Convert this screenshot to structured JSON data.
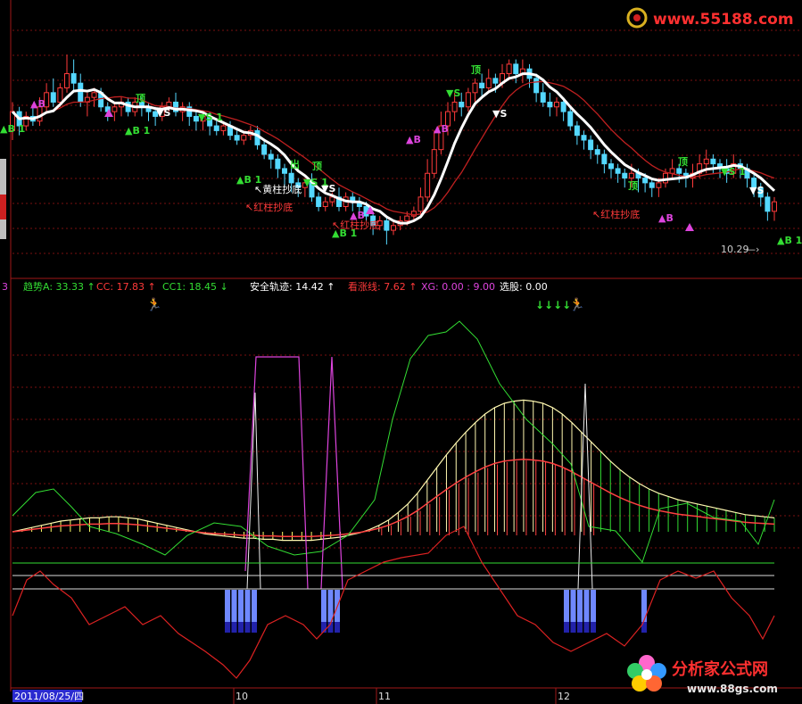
{
  "colors": {
    "background": "#000000",
    "grid": "#7a1010",
    "frame": "#a01818",
    "up": "#ff3a3a",
    "down": "#54d8ff",
    "white_line": "#ffffff",
    "red_line": "#c02020",
    "green": "#33dd33",
    "magenta": "#dd44dd",
    "yellow": "#ffff66",
    "blue_bar": "#6f88ff",
    "blue_dark": "#2222aa"
  },
  "watermarks": {
    "top": "www.55188.com",
    "bottom_title": "分析家公式网",
    "bottom_url": "www.88gs.com"
  },
  "indicator_header": {
    "prefix": "3",
    "items": [
      {
        "label": "趋势A: 33.33",
        "color": "#33dd33",
        "arrow": "↑"
      },
      {
        "label": "CC: 17.83",
        "color": "#ff3a3a",
        "arrow": "↑"
      },
      {
        "label": "CC1: 18.45",
        "color": "#33dd33",
        "arrow": "↓"
      },
      {
        "label": "安全轨迹: 14.42",
        "color": "#ffffff",
        "arrow": "↑"
      },
      {
        "label": "看涨线: 7.62",
        "color": "#ff3a3a",
        "arrow": "↑"
      },
      {
        "label": "XG: 0.00 : 9.00",
        "color": "#dd44dd",
        "arrow": ""
      },
      {
        "label": "选股: 0.00",
        "color": "#ffffff",
        "arrow": ""
      }
    ]
  },
  "price_annotations": {
    "price_label": "10.29",
    "bottom_signal": "▲B 1",
    "left_signal": "▲B 1",
    "green_arrows": "↓↓↓↓"
  },
  "signals": {
    "B1": "▲B 1",
    "S1": "▼S 1",
    "B": "▲B",
    "S": "▼S",
    "ding": "顶",
    "chu": "出",
    "chaodi": "↖红柱抄底",
    "chaodi2": "↖红柱抄底",
    "zhuchaodi": "↖黄柱抄底"
  },
  "date_axis": {
    "start_label": "2011/08/25/四",
    "months": [
      "10",
      "11",
      "12"
    ]
  },
  "chart_data": {
    "type": "candlestick",
    "title": "",
    "candles": [
      [
        52,
        56,
        50,
        58
      ],
      [
        56,
        53,
        51,
        57
      ],
      [
        53,
        55,
        52,
        56
      ],
      [
        55,
        54,
        53,
        57
      ],
      [
        54,
        57,
        53,
        59
      ],
      [
        57,
        60,
        56,
        62
      ],
      [
        60,
        58,
        57,
        63
      ],
      [
        58,
        61,
        57,
        62
      ],
      [
        61,
        64,
        60,
        68
      ],
      [
        64,
        62,
        60,
        67
      ],
      [
        62,
        58,
        57,
        64
      ],
      [
        58,
        59,
        55,
        60
      ],
      [
        59,
        60,
        57,
        61
      ],
      [
        60,
        57,
        56,
        61
      ],
      [
        57,
        56,
        54,
        58
      ],
      [
        56,
        57,
        54,
        58
      ],
      [
        57,
        58,
        55,
        59
      ],
      [
        58,
        56,
        55,
        59
      ],
      [
        56,
        58,
        55,
        59
      ],
      [
        58,
        57,
        55,
        59
      ],
      [
        57,
        56,
        54,
        58
      ],
      [
        56,
        55,
        53,
        57
      ],
      [
        55,
        57,
        54,
        58
      ],
      [
        57,
        58,
        56,
        59
      ],
      [
        58,
        56,
        55,
        60
      ],
      [
        56,
        57,
        54,
        58
      ],
      [
        57,
        55,
        53,
        58
      ],
      [
        55,
        54,
        52,
        56
      ],
      [
        54,
        55,
        52,
        56
      ],
      [
        55,
        53,
        51,
        56
      ],
      [
        53,
        52,
        51,
        54
      ],
      [
        52,
        53,
        51,
        54
      ],
      [
        53,
        51,
        50,
        54
      ],
      [
        51,
        50,
        49,
        52
      ],
      [
        50,
        51,
        49,
        52
      ],
      [
        51,
        52,
        50,
        53
      ],
      [
        52,
        49,
        48,
        53
      ],
      [
        49,
        47,
        46,
        50
      ],
      [
        47,
        46,
        44,
        48
      ],
      [
        46,
        44,
        42,
        47
      ],
      [
        44,
        43,
        40,
        45
      ],
      [
        43,
        41,
        39,
        44
      ],
      [
        41,
        40,
        38,
        42
      ],
      [
        40,
        41,
        38,
        42
      ],
      [
        41,
        38,
        37,
        43
      ],
      [
        38,
        36,
        35,
        39
      ],
      [
        36,
        37,
        35,
        38
      ],
      [
        37,
        38,
        36,
        39
      ],
      [
        38,
        36,
        35,
        40
      ],
      [
        36,
        38,
        35,
        39
      ],
      [
        38,
        37,
        35,
        39
      ],
      [
        37,
        36,
        34,
        38
      ],
      [
        36,
        34,
        33,
        37
      ],
      [
        34,
        32,
        30,
        35
      ],
      [
        32,
        33,
        31,
        34
      ],
      [
        33,
        31,
        28,
        34
      ],
      [
        31,
        32,
        30,
        33
      ],
      [
        32,
        33,
        31,
        34
      ],
      [
        33,
        34,
        32,
        35
      ],
      [
        34,
        35,
        33,
        36
      ],
      [
        35,
        38,
        34,
        40
      ],
      [
        38,
        43,
        37,
        46
      ],
      [
        43,
        48,
        42,
        52
      ],
      [
        48,
        53,
        47,
        56
      ],
      [
        53,
        56,
        51,
        58
      ],
      [
        56,
        58,
        54,
        60
      ],
      [
        58,
        57,
        55,
        60
      ],
      [
        57,
        60,
        56,
        61
      ],
      [
        60,
        62,
        58,
        63
      ],
      [
        62,
        61,
        59,
        64
      ],
      [
        61,
        63,
        60,
        65
      ],
      [
        63,
        62,
        60,
        64
      ],
      [
        62,
        64,
        61,
        66
      ],
      [
        64,
        66,
        63,
        67
      ],
      [
        66,
        64,
        62,
        67
      ],
      [
        64,
        65,
        62,
        67
      ],
      [
        65,
        63,
        61,
        66
      ],
      [
        63,
        60,
        58,
        64
      ],
      [
        60,
        58,
        57,
        62
      ],
      [
        58,
        57,
        55,
        60
      ],
      [
        57,
        58,
        55,
        59
      ],
      [
        58,
        56,
        54,
        59
      ],
      [
        56,
        53,
        52,
        57
      ],
      [
        53,
        51,
        49,
        54
      ],
      [
        51,
        50,
        48,
        52
      ],
      [
        50,
        48,
        46,
        51
      ],
      [
        48,
        47,
        45,
        49
      ],
      [
        47,
        45,
        43,
        48
      ],
      [
        45,
        44,
        42,
        46
      ],
      [
        44,
        43,
        41,
        45
      ],
      [
        43,
        42,
        40,
        44
      ],
      [
        42,
        43,
        40,
        45
      ],
      [
        43,
        42,
        39,
        44
      ],
      [
        42,
        41,
        39,
        43
      ],
      [
        41,
        40,
        38,
        42
      ],
      [
        40,
        41,
        38,
        42
      ],
      [
        41,
        43,
        40,
        44
      ],
      [
        43,
        44,
        42,
        46
      ],
      [
        44,
        43,
        41,
        45
      ],
      [
        43,
        42,
        40,
        44
      ],
      [
        42,
        43,
        40,
        45
      ],
      [
        43,
        45,
        42,
        47
      ],
      [
        45,
        46,
        43,
        48
      ],
      [
        46,
        45,
        43,
        47
      ],
      [
        45,
        44,
        42,
        46
      ],
      [
        44,
        43,
        41,
        46
      ],
      [
        43,
        45,
        42,
        47
      ],
      [
        45,
        44,
        42,
        46
      ],
      [
        44,
        42,
        40,
        45
      ],
      [
        42,
        40,
        38,
        43
      ],
      [
        40,
        38,
        36,
        41
      ],
      [
        38,
        35,
        33,
        39
      ],
      [
        35,
        37,
        33,
        38
      ]
    ],
    "osc_bars": [
      [
        2,
        2
      ],
      [
        2,
        2.2
      ],
      [
        2,
        2.4
      ],
      [
        2,
        2.6
      ],
      [
        2,
        2.8
      ],
      [
        2,
        3
      ],
      [
        2,
        3.1
      ],
      [
        2,
        3.2
      ],
      [
        2,
        3.3
      ],
      [
        2,
        3.3
      ],
      [
        2,
        3.4
      ],
      [
        2,
        3.4
      ],
      [
        2,
        3.3
      ],
      [
        2,
        3.2
      ],
      [
        2,
        3.0
      ],
      [
        2,
        2.8
      ],
      [
        2,
        2.6
      ],
      [
        2,
        2.4
      ],
      [
        2,
        2.2
      ],
      [
        2,
        2.0
      ],
      [
        2,
        1.8
      ],
      [
        2,
        1.7
      ],
      [
        2,
        1.6
      ],
      [
        2,
        1.5
      ],
      [
        2,
        1.4
      ],
      [
        2,
        1.4
      ],
      [
        2,
        1.3
      ],
      [
        2,
        1.3
      ],
      [
        2,
        1.2
      ],
      [
        2,
        1.2
      ],
      [
        2,
        1.2
      ],
      [
        2,
        1.2
      ],
      [
        2,
        1.3
      ],
      [
        2,
        1.4
      ],
      [
        2,
        1.5
      ],
      [
        2,
        1.7
      ],
      [
        2,
        1.9
      ],
      [
        2,
        2.2
      ],
      [
        2,
        2.6
      ],
      [
        2,
        3.1
      ],
      [
        2,
        3.8
      ],
      [
        2,
        4.6
      ],
      [
        2,
        5.6
      ],
      [
        2,
        6.8
      ],
      [
        2,
        8.0
      ],
      [
        2,
        9.2
      ],
      [
        2,
        10.3
      ],
      [
        2,
        11.3
      ],
      [
        2,
        12.2
      ],
      [
        2,
        13.0
      ],
      [
        2,
        13.6
      ],
      [
        2,
        14.0
      ],
      [
        2,
        14.2
      ],
      [
        2,
        14.3
      ],
      [
        2,
        14.2
      ],
      [
        2,
        14.0
      ],
      [
        2,
        13.6
      ],
      [
        2,
        13.0
      ],
      [
        2,
        12.2
      ],
      [
        2,
        11.3
      ],
      [
        2,
        10.4
      ],
      [
        2,
        9.5
      ],
      [
        2,
        8.6
      ],
      [
        2,
        7.8
      ],
      [
        2,
        7.1
      ],
      [
        2,
        6.5
      ],
      [
        2,
        6.0
      ],
      [
        2,
        5.6
      ],
      [
        2,
        5.3
      ],
      [
        2,
        5.0
      ],
      [
        2,
        4.8
      ],
      [
        2,
        4.6
      ],
      [
        2,
        4.4
      ],
      [
        2,
        4.2
      ],
      [
        2,
        4.0
      ],
      [
        2,
        3.8
      ],
      [
        2,
        3.6
      ],
      [
        2,
        3.5
      ],
      [
        2,
        3.4
      ],
      [
        2,
        3.3
      ]
    ]
  }
}
